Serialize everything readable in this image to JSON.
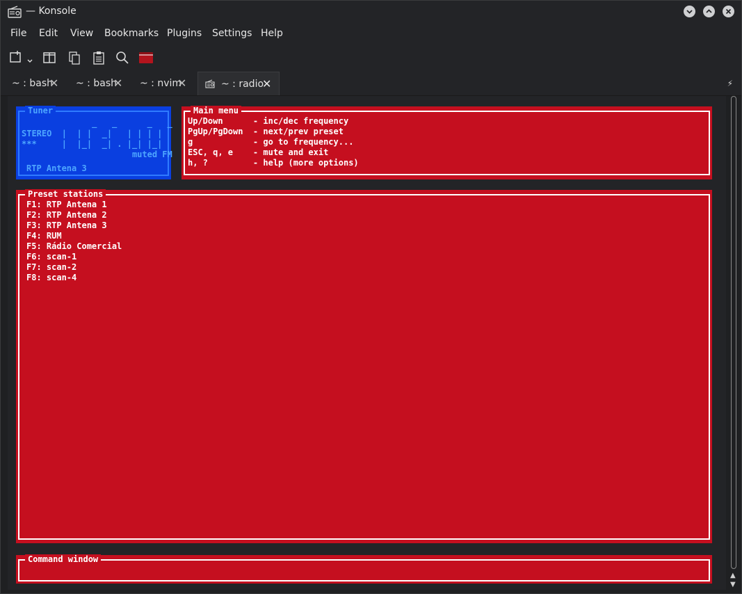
{
  "window": {
    "title": "— Konsole"
  },
  "menubar": [
    "File",
    "Edit",
    "View",
    "Bookmarks",
    "Plugins",
    "Settings",
    "Help"
  ],
  "tabs": [
    {
      "label": "~ : bash",
      "active": false
    },
    {
      "label": "~ : bash",
      "active": false
    },
    {
      "label": "~ : nvim",
      "active": false
    },
    {
      "label": "~ : radio",
      "active": true
    }
  ],
  "toolbar_icons": [
    "new-tab-icon",
    "split-view-icon",
    "copy-icon",
    "paste-icon",
    "search-icon",
    "folder-icon"
  ],
  "terminal": {
    "tuner": {
      "title": "Tuner",
      "lines": [
        "              _   _      _   _",
        "STEREO  |  | |  _|   | | | |",
        "***     |  |_|  _| . |_| |_|",
        "                      muted FM"
      ],
      "station": "RTP Antena 3"
    },
    "main_menu": {
      "title": "Main menu",
      "lines": [
        "Up/Down      - inc/dec frequency",
        "PgUp/PgDown  - next/prev preset",
        "g            - go to frequency...",
        "ESC, q, e    - mute and exit",
        "h, ?         - help (more options)"
      ]
    },
    "presets": {
      "title": "Preset stations",
      "items": [
        "F1: RTP Antena 1",
        "F2: RTP Antena 2",
        "F3: RTP Antena 3",
        "F4: RUM",
        "F5: Rádio Comercial",
        "F6: scan-1",
        "F7: scan-2",
        "F8: scan-4"
      ]
    },
    "command_window": {
      "title": "Command window"
    }
  },
  "colors": {
    "tuner_bg": "#0a3fe0",
    "panel_bg": "#c50f1f",
    "tuner_text": "#4da6ff"
  }
}
